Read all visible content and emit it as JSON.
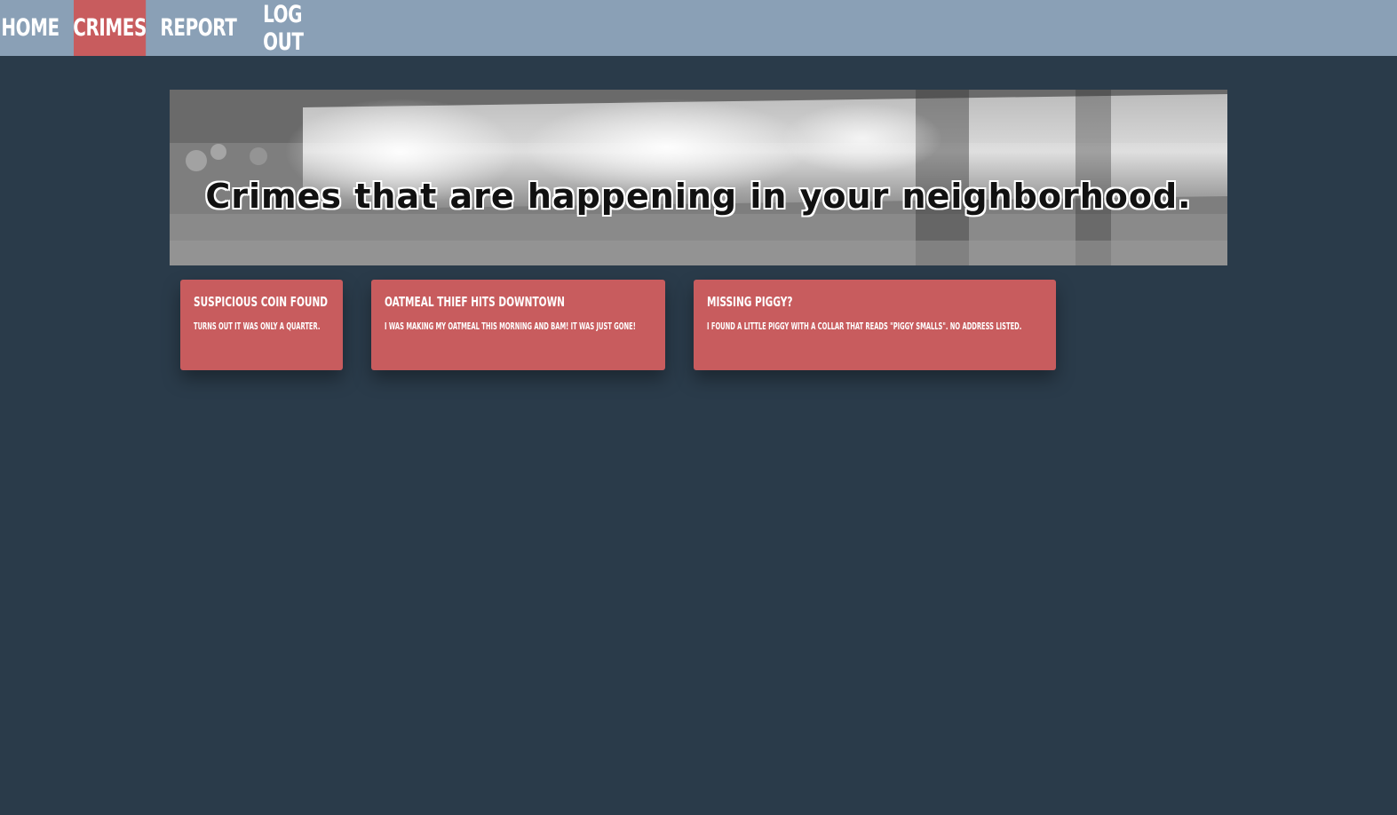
{
  "nav": {
    "items": [
      {
        "label": "HOME",
        "active": false
      },
      {
        "label": "CRIMES",
        "active": true
      },
      {
        "label": "REPORT",
        "active": false
      },
      {
        "label": "LOG OUT",
        "active": false
      }
    ]
  },
  "banner": {
    "title": "Crimes that are happening in your neighborhood."
  },
  "cards": [
    {
      "title": "SUSPICIOUS COIN FOUND",
      "text": "TURNS OUT IT WAS ONLY A QUARTER."
    },
    {
      "title": "OATMEAL THIEF HITS DOWNTOWN",
      "text": "I WAS MAKING MY OATMEAL THIS MORNING AND BAM! IT WAS JUST GONE!"
    },
    {
      "title": "MISSING PIGGY?",
      "text": "I FOUND A LITTLE PIGGY WITH A COLLAR THAT READS \"PIGGY SMALLS\". NO ADDRESS LISTED."
    }
  ],
  "colors": {
    "background": "#2a3b4a",
    "navbar": "#8aa0b6",
    "accent": "#c85c5e"
  }
}
